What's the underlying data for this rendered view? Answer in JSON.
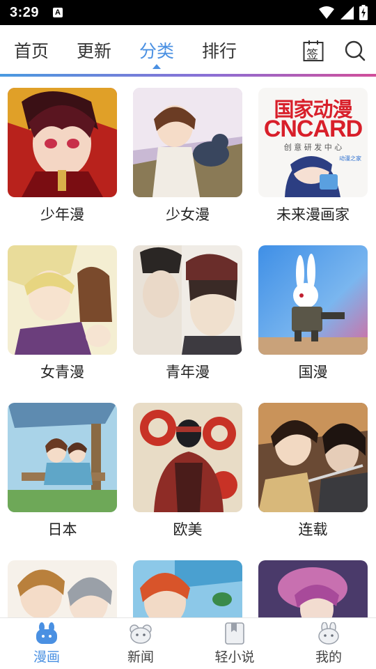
{
  "status_bar": {
    "time": "3:29",
    "notification_glyph": "A",
    "icons": [
      "wifi-icon",
      "signal-icon",
      "battery-charging-icon"
    ]
  },
  "top_nav": {
    "tabs": [
      {
        "label": "首页",
        "active": false
      },
      {
        "label": "更新",
        "active": false
      },
      {
        "label": "分类",
        "active": true
      },
      {
        "label": "排行",
        "active": false
      }
    ],
    "sign_in_glyph": "签",
    "search_icon": "search-icon",
    "accent_color": "#4a90e2"
  },
  "categories": [
    {
      "label": "少年漫",
      "cover": "cover-shonen"
    },
    {
      "label": "少女漫",
      "cover": "cover-shojo"
    },
    {
      "label": "未来漫画家",
      "cover": "cover-future-artist",
      "cover_text": {
        "line1": "国家动漫",
        "line2": "CNCARD",
        "line3": "创 意 研 发 中 心",
        "badge": "动漫之家"
      }
    },
    {
      "label": "女青漫",
      "cover": "cover-josei"
    },
    {
      "label": "青年漫",
      "cover": "cover-seinen"
    },
    {
      "label": "国漫",
      "cover": "cover-guoman"
    },
    {
      "label": "日本",
      "cover": "cover-japan"
    },
    {
      "label": "欧美",
      "cover": "cover-western"
    },
    {
      "label": "连载",
      "cover": "cover-serial"
    },
    {
      "label": "",
      "cover": "cover-partial-1"
    },
    {
      "label": "",
      "cover": "cover-partial-2"
    },
    {
      "label": "",
      "cover": "cover-partial-3"
    }
  ],
  "bottom_nav": {
    "items": [
      {
        "label": "漫画",
        "icon": "comic-rabbit-icon",
        "active": true
      },
      {
        "label": "新闻",
        "icon": "news-mouse-icon",
        "active": false
      },
      {
        "label": "轻小说",
        "icon": "bookmark-book-icon",
        "active": false
      },
      {
        "label": "我的",
        "icon": "profile-rabbit-icon",
        "active": false
      }
    ]
  }
}
